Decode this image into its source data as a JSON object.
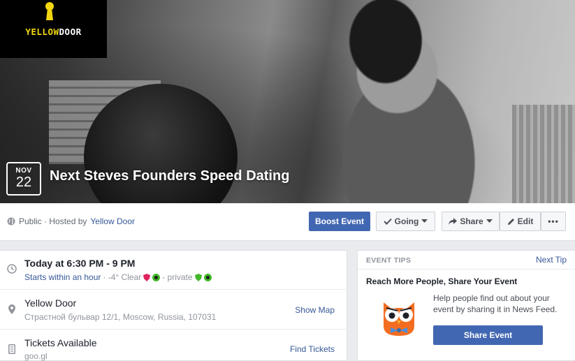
{
  "logo": {
    "text_yellow": "YELLOW",
    "text_white": "DOOR"
  },
  "event": {
    "month": "NOV",
    "day": "22",
    "title": "Next Steves Founders Speed Dating"
  },
  "actionbar": {
    "privacy_prefix": "Public · Hosted by",
    "host": "Yellow Door",
    "boost_label": "Boost Event",
    "going_label": "Going",
    "share_label": "Share",
    "edit_label": "Edit",
    "more_label": "•••"
  },
  "details": {
    "time": {
      "title": "Today at 6:30 PM - 9 PM",
      "starts": "Starts within an hour",
      "weather": "· -4° Clear",
      "privacy": "- private"
    },
    "location": {
      "title": "Yellow Door",
      "address": "Страстной бульвар 12/1, Moscow, Russia, 107031",
      "action": "Show Map"
    },
    "tickets": {
      "title": "Tickets Available",
      "url": "goo.gl",
      "action": "Find Tickets"
    }
  },
  "tips": {
    "label": "EVENT TIPS",
    "next": "Next Tip",
    "heading": "Reach More People, Share Your Event",
    "body": "Help people find out about your event by sharing it in News Feed.",
    "button": "Share Event"
  },
  "colors": {
    "accent": "#4267b2",
    "link": "#365899",
    "logo_yellow": "#f2d50f"
  }
}
